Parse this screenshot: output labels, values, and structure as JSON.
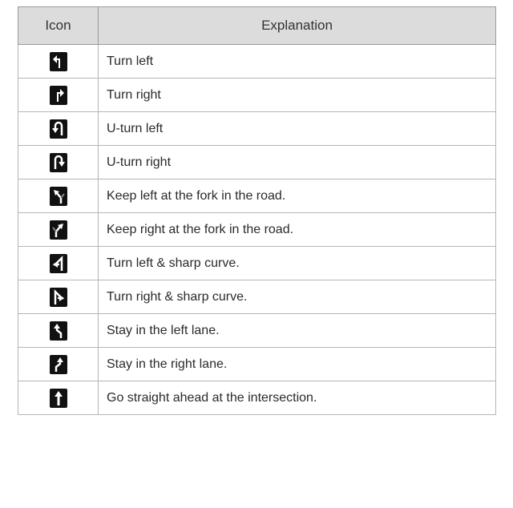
{
  "table": {
    "headers": {
      "icon": "Icon",
      "explanation": "Explanation"
    },
    "rows": [
      {
        "icon": "turn-left-icon",
        "explanation": "Turn left"
      },
      {
        "icon": "turn-right-icon",
        "explanation": "Turn right"
      },
      {
        "icon": "u-turn-left-icon",
        "explanation": "U-turn left"
      },
      {
        "icon": "u-turn-right-icon",
        "explanation": "U-turn right"
      },
      {
        "icon": "keep-left-fork-icon",
        "explanation": "Keep left at the fork in the road."
      },
      {
        "icon": "keep-right-fork-icon",
        "explanation": "Keep right at the fork in the road."
      },
      {
        "icon": "sharp-left-curve-icon",
        "explanation": "Turn left & sharp curve."
      },
      {
        "icon": "sharp-right-curve-icon",
        "explanation": "Turn right & sharp curve."
      },
      {
        "icon": "stay-left-lane-icon",
        "explanation": "Stay in the left lane."
      },
      {
        "icon": "stay-right-lane-icon",
        "explanation": "Stay in the right lane."
      },
      {
        "icon": "straight-ahead-icon",
        "explanation": "Go straight ahead at the intersection."
      }
    ]
  }
}
